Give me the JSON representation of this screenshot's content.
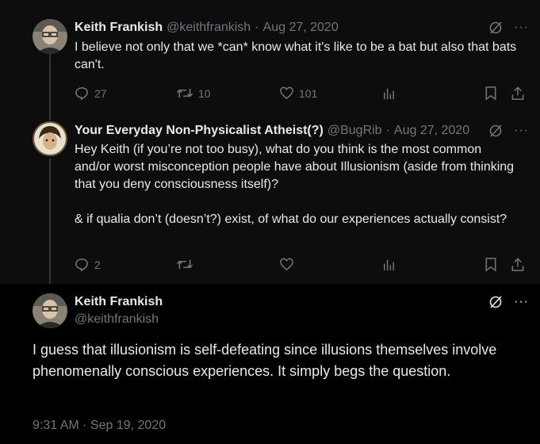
{
  "tweets": [
    {
      "name": "Keith Frankish",
      "handle": "@keithfrankish",
      "date": "Aug 27, 2020",
      "text": [
        "I believe not only that we *can* know what it's like to be a bat but also that bats can't."
      ],
      "replies": "27",
      "retweets": "10",
      "likes": "101"
    },
    {
      "name": "Your Everyday Non-Physicalist Atheist(?)",
      "handle": "@BugRib",
      "date": "Aug 27, 2020",
      "text": [
        "Hey Keith (if you’re not too busy), what do you think is the most common and/or worst misconception people have about Illusionism (aside from thinking that you deny consciousness itself)?",
        "& if qualia don’t (doesn’t?) exist, of what do our experiences actually consist?"
      ],
      "replies": "2",
      "retweets": "",
      "likes": ""
    },
    {
      "name": "Keith Frankish",
      "handle": "@keithfrankish",
      "text": "I guess that illusionism is self-defeating since illusions themselves involve phenomenally conscious experiences. It simply begs the question.",
      "timestamp": "9:31 AM · Sep 19, 2020"
    }
  ],
  "separator": "·",
  "more_glyph": "···"
}
